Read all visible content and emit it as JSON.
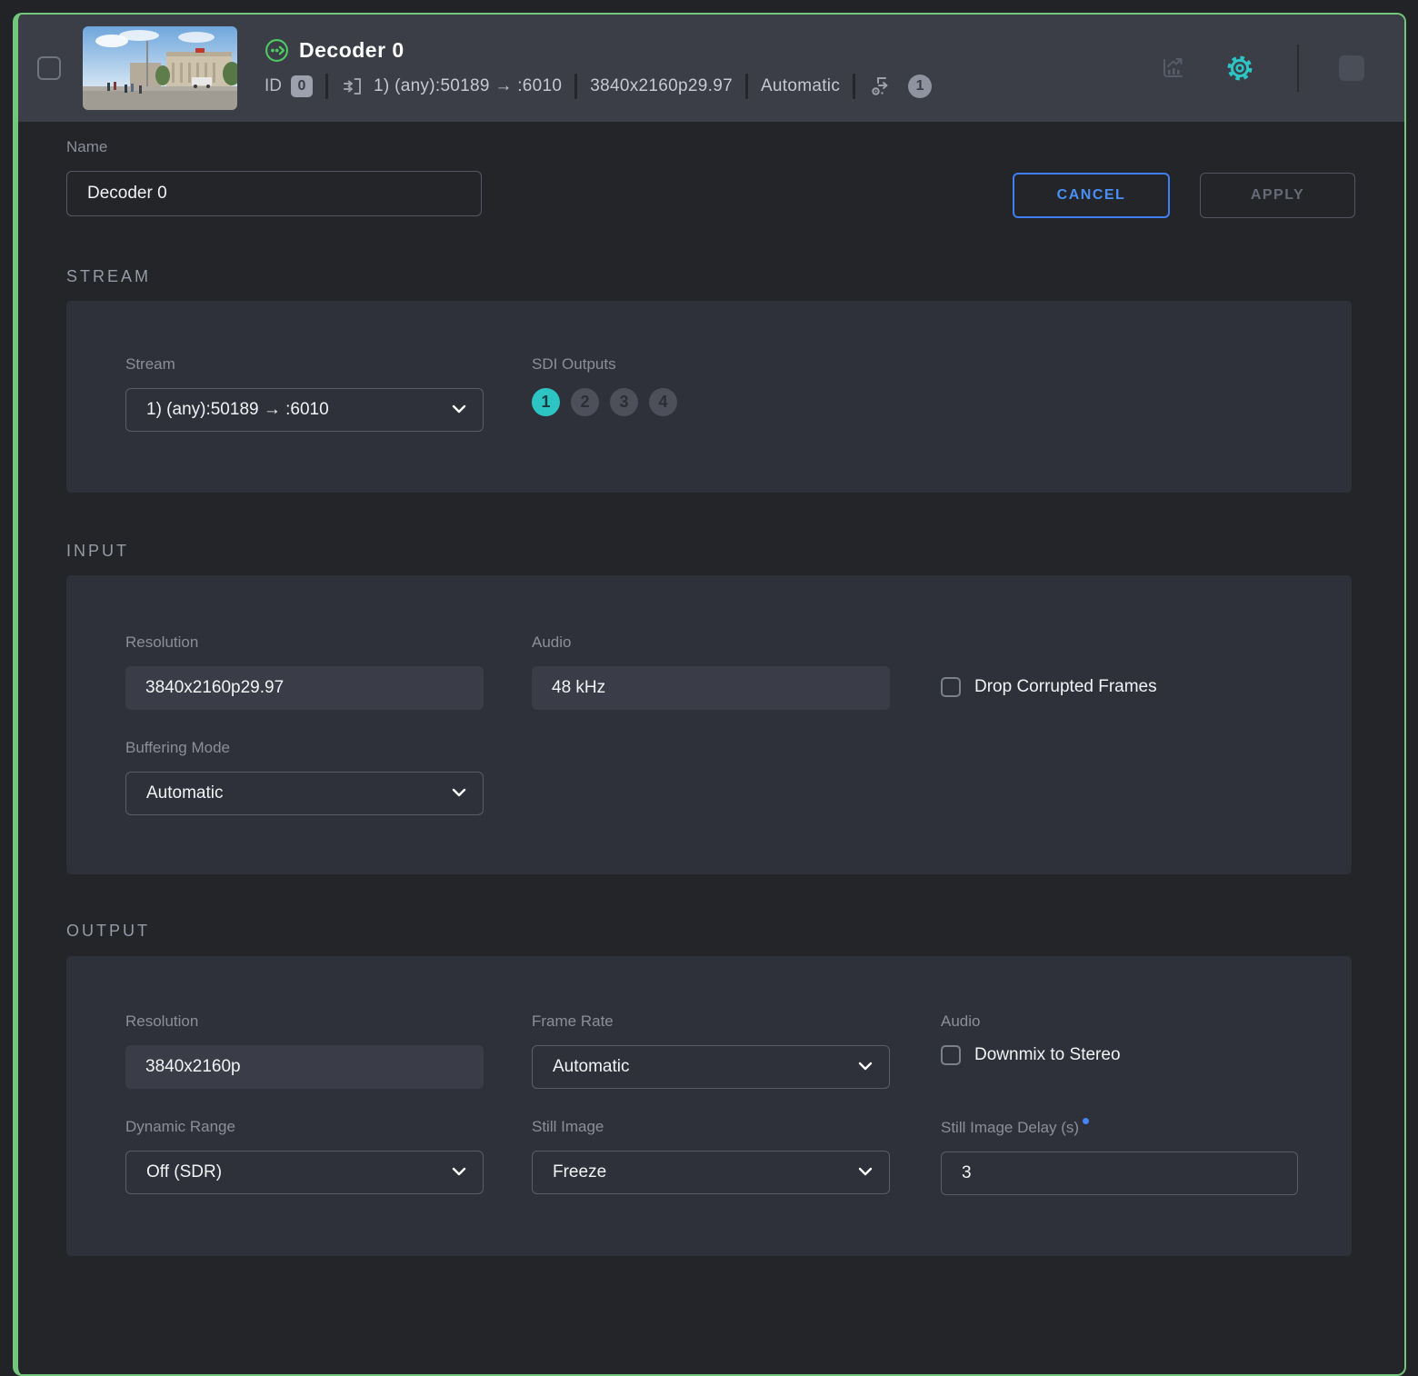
{
  "colors": {
    "accent_green": "#72c77c",
    "accent_teal": "#2cc5c3",
    "accent_blue": "#4287f5"
  },
  "header": {
    "title": "Decoder 0",
    "id_label": "ID",
    "id_value": "0",
    "stream_route": "1) (any):50189 → :6010",
    "resolution": "3840x2160p29.97",
    "buffering": "Automatic",
    "sdi_output_count": "1"
  },
  "name_field": {
    "label": "Name",
    "value": "Decoder 0"
  },
  "actions": {
    "cancel": "CANCEL",
    "apply": "APPLY"
  },
  "stream_section": {
    "title": "STREAM",
    "stream_label": "Stream",
    "stream_value": "1) (any):50189 → :6010",
    "sdi_label": "SDI Outputs",
    "sdi_options": [
      {
        "label": "1",
        "selected": true
      },
      {
        "label": "2",
        "selected": false
      },
      {
        "label": "3",
        "selected": false
      },
      {
        "label": "4",
        "selected": false
      }
    ]
  },
  "input_section": {
    "title": "INPUT",
    "resolution_label": "Resolution",
    "resolution_value": "3840x2160p29.97",
    "audio_label": "Audio",
    "audio_value": "48 kHz",
    "drop_corrupted_label": "Drop Corrupted Frames",
    "drop_corrupted_checked": false,
    "buffering_label": "Buffering Mode",
    "buffering_value": "Automatic"
  },
  "output_section": {
    "title": "OUTPUT",
    "resolution_label": "Resolution",
    "resolution_value": "3840x2160p",
    "frame_rate_label": "Frame Rate",
    "frame_rate_value": "Automatic",
    "audio_label": "Audio",
    "downmix_label": "Downmix to Stereo",
    "downmix_checked": false,
    "dynamic_range_label": "Dynamic Range",
    "dynamic_range_value": "Off (SDR)",
    "still_image_label": "Still Image",
    "still_image_value": "Freeze",
    "still_delay_label": "Still Image Delay (s)",
    "still_delay_value": "3"
  }
}
